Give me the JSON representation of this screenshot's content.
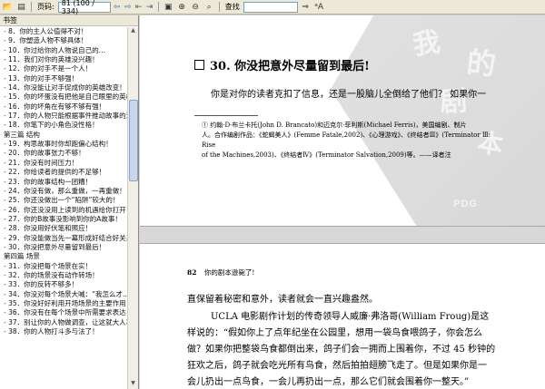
{
  "toolbar": {
    "page_label": "页码:",
    "page_value": "81 (100 / 334)",
    "search_label": "查找",
    "search_value": "",
    "icons": [
      "open-icon",
      "save-icon",
      "print-icon",
      "prev-page-icon",
      "next-page-icon",
      "first-page-icon",
      "last-page-icon",
      "fit-page-icon",
      "zoom-in-icon",
      "zoom-out-icon",
      "select-text-icon",
      "text-size-icon"
    ]
  },
  "sidebar": {
    "header": "书签",
    "items": [
      {
        "label": "8．你的主人公值得不对！",
        "kind": "entry"
      },
      {
        "label": "9．你塑造人物不够具体！",
        "kind": "entry"
      },
      {
        "label": "10．你过给你的人物说自己的…",
        "kind": "entry"
      },
      {
        "label": "11．我们对你的英雄没兴趣！",
        "kind": "entry"
      },
      {
        "label": "12．你的对手不是一个人！",
        "kind": "entry"
      },
      {
        "label": "13．你的对手不够强！",
        "kind": "entry"
      },
      {
        "label": "14．你没能让对手促成你的英雄改变！",
        "kind": "entry"
      },
      {
        "label": "15．你的坏蛋没有把他是自己眼里的英雄！",
        "kind": "entry"
      },
      {
        "label": "16．你的坏角在有够不够有强！",
        "kind": "entry"
      },
      {
        "label": "17．你的人物只能根据事件推动故事的进展！",
        "kind": "entry"
      },
      {
        "label": "18．你笔下的小角色没性格！",
        "kind": "entry"
      },
      {
        "label": "第三篇 结构",
        "kind": "section"
      },
      {
        "label": "19．构思故事时你却跑偏心结构！",
        "kind": "entry"
      },
      {
        "label": "20．你的故事张力不够！",
        "kind": "entry"
      },
      {
        "label": "21．你没有时间压力！",
        "kind": "entry"
      },
      {
        "label": "22．你给读者的提供的不足够！",
        "kind": "entry"
      },
      {
        "label": "23．你的故事结构一团糟！",
        "kind": "entry"
      },
      {
        "label": "24．你没有做，那么重做，一再重做！",
        "kind": "entry"
      },
      {
        "label": "25．你还没做出一个“陷阱”较大的！",
        "kind": "entry"
      },
      {
        "label": "26．你还没没用上读到的机遇给你打开！",
        "kind": "entry"
      },
      {
        "label": "27．你的B故事没影响到你的A故事！",
        "kind": "entry"
      },
      {
        "label": "28．你没用好伏笔和照应！",
        "kind": "entry"
      },
      {
        "label": "29．你没能做当先一幕形成好结合好关系！",
        "kind": "entry"
      },
      {
        "label": "30．你没把意外尽量留到最后！",
        "kind": "entry"
      },
      {
        "label": "第四篇 场景",
        "kind": "section"
      },
      {
        "label": "31．你没把每个场景在实！",
        "kind": "entry"
      },
      {
        "label": "32．你的场景没有动作转场！",
        "kind": "entry"
      },
      {
        "label": "33．你的反转不够多！",
        "kind": "entry"
      },
      {
        "label": "34．你没对每个场景大喊：“我怎么才…",
        "kind": "entry"
      },
      {
        "label": "35．你没好好利用开场场景的主要作用！",
        "kind": "entry"
      },
      {
        "label": "36．你没有在每个场景中所需要求表达！",
        "kind": "entry"
      },
      {
        "label": "37．别让你的人物做调查，让这就大人事！",
        "kind": "entry"
      },
      {
        "label": "38．你的人物打斗多与法了！",
        "kind": "entry"
      }
    ]
  },
  "watermark": {
    "chars": [
      "我",
      "的",
      "剧",
      "本"
    ],
    "brand": "PDG"
  },
  "page1": {
    "section_title": "30. 你没把意外尽量留到最后!",
    "subtitle": "你是对你的读者克扣了信息，还是一股脑儿全倒给了他们？ 如果你一",
    "footnote_1": "① 约翰·D·布兰卡托(John D. Brancato)和迈克尔·菲利斯(Michael Ferris)，美国编剧、制片",
    "footnote_2": "人。合作编剧作品：《蛇蝎美人》(Femme Fatale,2002)、《心理游戏》、《终结者Ⅲ》(Terminator Ⅲ: Rise",
    "footnote_3": "of the Machines,2003)、《终结者Ⅳ》(Terminator Salvation,2009)等。——译者注"
  },
  "page2": {
    "page_number": "82",
    "running_head": "你的剧本逊毙了!",
    "para_1": "直保留着秘密和意外，读者就会一直兴趣盎然。",
    "para_2_line_1": "UCLA 电影剧作计划的传奇领导人威廉·弗洛哥(William Froug)是这",
    "para_2_line_2": "样说的：“假如你上了点年纪坐在公园里，想用一袋鸟食喂鸽子，你会怎么",
    "para_2_line_3": "做？如果你把整袋鸟食都倒出来，鸽子们会一拥而上围着你，不过 45 秒钟的",
    "para_2_line_4": "狂欢之后，鸽子就会吃光所有鸟食，然后拍拍翅膀飞走了。但是如果你是一",
    "para_2_line_5": "会儿扔出一点鸟食，一会儿再扔出一点，那么它们就会围着你一整天。”"
  }
}
